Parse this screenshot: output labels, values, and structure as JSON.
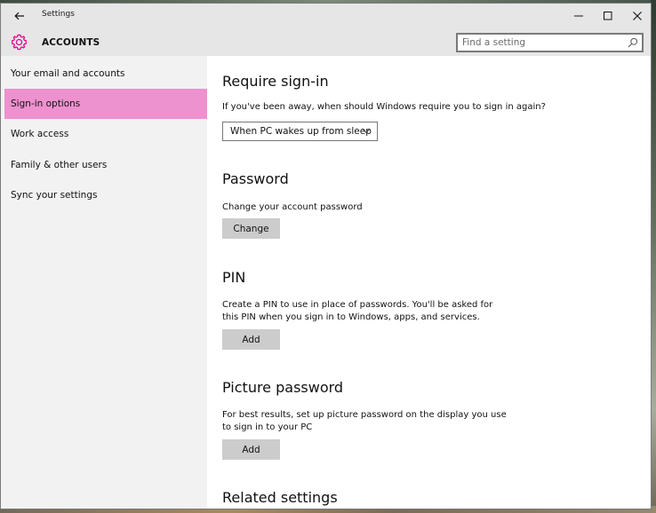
{
  "window": {
    "title": "Settings"
  },
  "header": {
    "title": "ACCOUNTS",
    "accent_color": "#e3008c"
  },
  "search": {
    "placeholder": "Find a setting"
  },
  "sidebar": {
    "items": [
      {
        "label": "Your email and accounts",
        "selected": false
      },
      {
        "label": "Sign-in options",
        "selected": true
      },
      {
        "label": "Work access",
        "selected": false
      },
      {
        "label": "Family & other users",
        "selected": false
      },
      {
        "label": "Sync your settings",
        "selected": false
      }
    ],
    "selected_color": "#ee91cf"
  },
  "content": {
    "require_signin": {
      "title": "Require sign-in",
      "description": "If you've been away, when should Windows require you to sign in again?",
      "dropdown_value": "When PC wakes up from sleep"
    },
    "password": {
      "title": "Password",
      "description": "Change your account password",
      "button": "Change"
    },
    "pin": {
      "title": "PIN",
      "description": "Create a PIN to use in place of passwords. You'll be asked for this PIN when you sign in to Windows, apps, and services.",
      "button": "Add"
    },
    "picture_password": {
      "title": "Picture password",
      "description": "For best results, set up picture password on the display you use to sign in to your PC",
      "button": "Add"
    },
    "related": {
      "title": "Related settings"
    }
  }
}
